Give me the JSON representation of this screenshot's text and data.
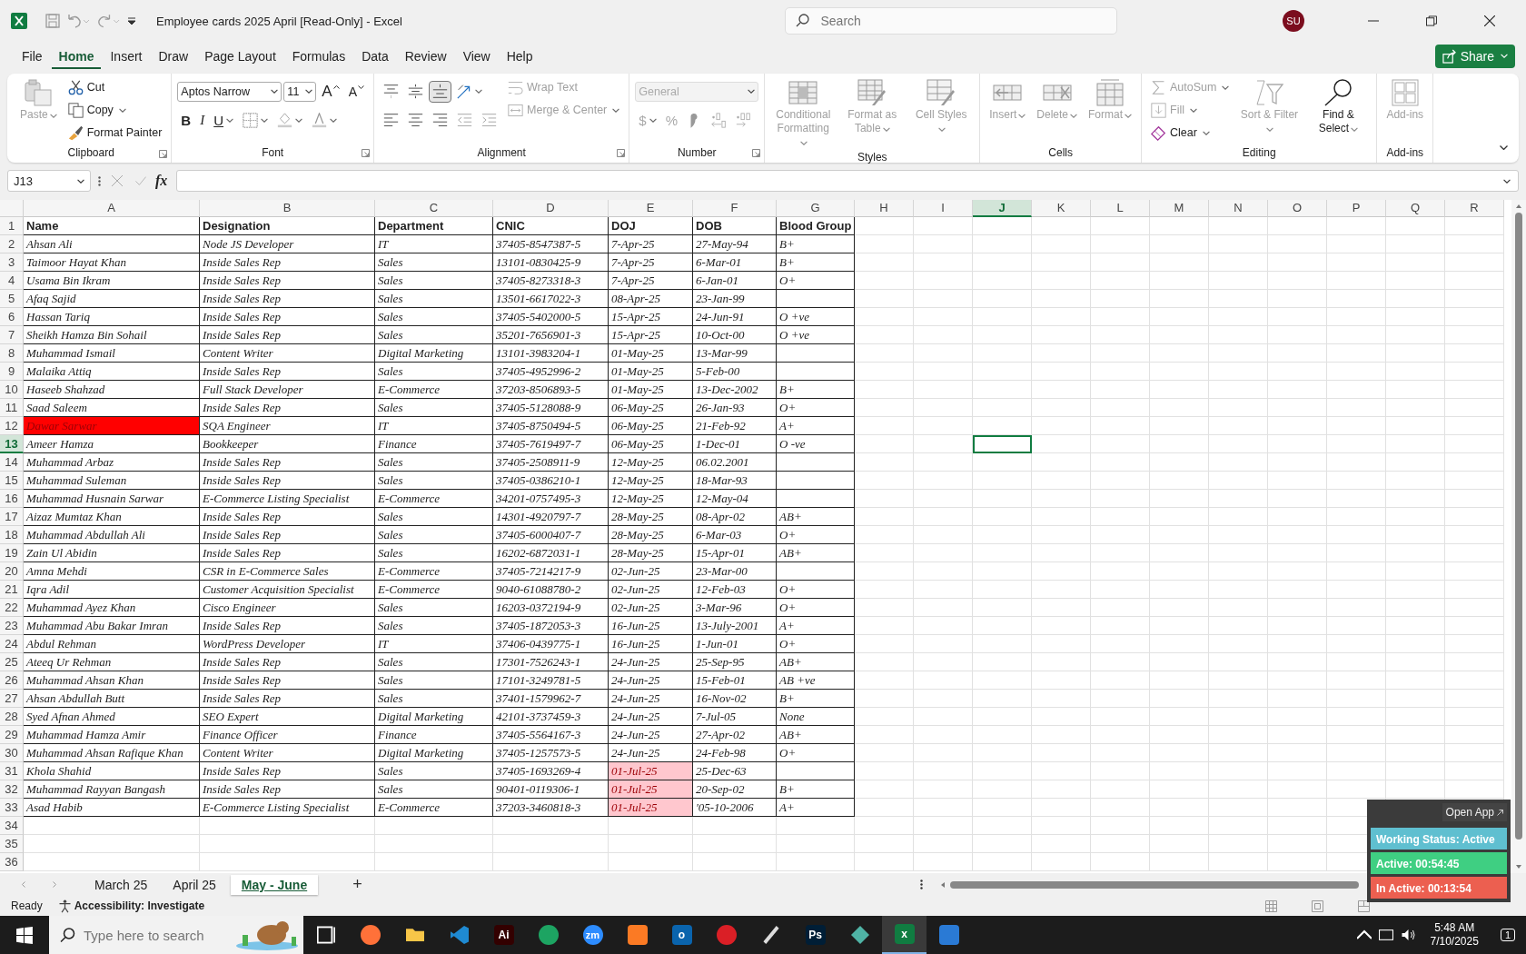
{
  "window": {
    "title": "Employee cards 2025 April  [Read-Only]  -  Excel",
    "search_placeholder": "Search",
    "avatar": "SU"
  },
  "menu_tabs": [
    {
      "label": "File",
      "selected": false
    },
    {
      "label": "Home",
      "selected": true
    },
    {
      "label": "Insert",
      "selected": false
    },
    {
      "label": "Draw",
      "selected": false
    },
    {
      "label": "Page Layout",
      "selected": false
    },
    {
      "label": "Formulas",
      "selected": false
    },
    {
      "label": "Data",
      "selected": false
    },
    {
      "label": "Review",
      "selected": false
    },
    {
      "label": "View",
      "selected": false
    },
    {
      "label": "Help",
      "selected": false
    }
  ],
  "share": "Share",
  "ribbon": [
    {
      "name": "Clipboard",
      "buttons": [
        {
          "label": "Paste",
          "disabled": true
        },
        {
          "label": "Cut",
          "disabled": false
        },
        {
          "label": "Copy",
          "disabled": false
        },
        {
          "label": "Format Painter",
          "disabled": false
        }
      ]
    },
    {
      "name": "Font",
      "font": "Aptos Narrow",
      "size": "11",
      "buttons": [
        {
          "label": "A",
          "disabled": false
        },
        {
          "label": "A",
          "disabled": false
        },
        {
          "label": "B",
          "disabled": false
        },
        {
          "label": "I",
          "disabled": false
        },
        {
          "label": "U",
          "disabled": false
        }
      ]
    },
    {
      "name": "Alignment",
      "vertical": [
        {
          "selected": false
        },
        {
          "selected": false
        },
        {
          "selected": true
        }
      ],
      "buttons": [
        {
          "label": "Wrap Text",
          "disabled": true
        },
        {
          "label": "Merge & Center",
          "disabled": true
        }
      ]
    },
    {
      "name": "Number",
      "number_format": {
        "value": "General",
        "disabled": true
      },
      "buttons": [
        {
          "label": "$",
          "disabled": true
        },
        {
          "label": "%",
          "disabled": true
        }
      ]
    },
    {
      "name": "Styles",
      "buttons": [
        {
          "label": "Conditional Formatting",
          "disabled": true
        },
        {
          "label": "Format as Table",
          "disabled": true
        },
        {
          "label": "Cell Styles",
          "disabled": true
        }
      ]
    },
    {
      "name": "Cells",
      "buttons": [
        {
          "label": "Insert",
          "disabled": true
        },
        {
          "label": "Delete",
          "disabled": true
        },
        {
          "label": "Format",
          "disabled": true
        }
      ]
    },
    {
      "name": "Editing",
      "buttons": [
        {
          "label": "AutoSum",
          "disabled": true
        },
        {
          "label": "Fill",
          "disabled": true
        },
        {
          "label": "Clear",
          "disabled": false
        },
        {
          "label": "Sort & Filter",
          "disabled": true
        },
        {
          "label": "Find & Select",
          "disabled": false
        }
      ]
    },
    {
      "name": "Add-ins",
      "buttons": [
        {
          "label": "Add-ins",
          "disabled": true
        }
      ]
    }
  ],
  "formula_bar": {
    "name_box": "J13",
    "fx": "fx"
  },
  "sheet": {
    "columns": [
      {
        "label": "A",
        "selected": false
      },
      {
        "label": "B",
        "selected": false
      },
      {
        "label": "C",
        "selected": false
      },
      {
        "label": "D",
        "selected": false
      },
      {
        "label": "E",
        "selected": false
      },
      {
        "label": "F",
        "selected": false
      },
      {
        "label": "G",
        "selected": false
      },
      {
        "label": "H",
        "selected": false
      },
      {
        "label": "I",
        "selected": false
      },
      {
        "label": "J",
        "selected": true
      },
      {
        "label": "K",
        "selected": false
      },
      {
        "label": "L",
        "selected": false
      },
      {
        "label": "M",
        "selected": false
      },
      {
        "label": "N",
        "selected": false
      },
      {
        "label": "O",
        "selected": false
      },
      {
        "label": "P",
        "selected": false
      },
      {
        "label": "Q",
        "selected": false
      },
      {
        "label": "R",
        "selected": false
      }
    ],
    "rows": [
      {
        "number": "1",
        "kind": "header",
        "selected": false,
        "cells": [
          "Name",
          "Designation",
          "Department",
          "CNIC",
          "DOJ",
          "DOB",
          "Blood Group"
        ]
      },
      {
        "number": "2",
        "kind": "data",
        "selected": false,
        "cells": [
          "Ahsan Ali",
          "Node JS Developer",
          "IT",
          "37405-8547387-5",
          "7-Apr-25",
          "27-May-94",
          "B+"
        ]
      },
      {
        "number": "3",
        "kind": "data",
        "selected": false,
        "cells": [
          "Taimoor Hayat Khan",
          "Inside Sales Rep",
          "Sales",
          "13101-0830425-9",
          "7-Apr-25",
          "6-Mar-01",
          "B+"
        ]
      },
      {
        "number": "4",
        "kind": "data",
        "selected": false,
        "cells": [
          "Usama Bin Ikram",
          "Inside Sales Rep",
          "Sales",
          "37405-8273318-3",
          "7-Apr-25",
          "6-Jan-01",
          "O+"
        ]
      },
      {
        "number": "5",
        "kind": "data",
        "selected": false,
        "cells": [
          "Afaq Sajid",
          "Inside Sales Rep",
          "Sales",
          "13501-6617022-3",
          "08-Apr-25",
          "23-Jan-99",
          null
        ]
      },
      {
        "number": "6",
        "kind": "data",
        "selected": false,
        "cells": [
          "Hassan Tariq",
          "Inside Sales Rep",
          "Sales",
          "37405-5402000-5",
          "15-Apr-25",
          "24-Jun-91",
          "O +ve"
        ]
      },
      {
        "number": "7",
        "kind": "data",
        "selected": false,
        "cells": [
          "Sheikh Hamza Bin Sohail",
          "Inside Sales Rep",
          "Sales",
          "35201-7656901-3",
          "15-Apr-25",
          "10-Oct-00",
          "O +ve"
        ]
      },
      {
        "number": "8",
        "kind": "data",
        "selected": false,
        "cells": [
          "Muhammad Ismail",
          "Content Writer",
          "Digital Marketing",
          "13101-3983204-1",
          "01-May-25",
          "13-Mar-99",
          null
        ]
      },
      {
        "number": "9",
        "kind": "data",
        "selected": false,
        "cells": [
          "Malaika Attiq",
          "Inside Sales Rep",
          "Sales",
          "37405-4952996-2",
          "01-May-25",
          "5-Feb-00",
          null
        ]
      },
      {
        "number": "10",
        "kind": "data",
        "selected": false,
        "cells": [
          "Haseeb Shahzad",
          "Full Stack Developer",
          "E-Commerce",
          "37203-8506893-5",
          "01-May-25",
          "13-Dec-2002",
          "B+"
        ]
      },
      {
        "number": "11",
        "kind": "data",
        "selected": false,
        "cells": [
          "Saad Saleem",
          "Inside Sales Rep",
          "Sales",
          "37405-5128088-9",
          "06-May-25",
          "26-Jan-93",
          "O+"
        ]
      },
      {
        "number": "12",
        "kind": "data",
        "selected": false,
        "cells": [
          {
            "text": "Dawar Sarwar",
            "color": "#ff0000"
          },
          "SQA Engineer",
          "IT",
          "37405-8750494-5",
          "06-May-25",
          "21-Feb-92",
          "A+"
        ]
      },
      {
        "number": "13",
        "kind": "data",
        "selected": true,
        "cells": [
          "Ameer Hamza",
          "Bookkeeper",
          "Finance",
          "37405-7619497-7",
          "06-May-25",
          "1-Dec-01",
          "O -ve"
        ]
      },
      {
        "number": "14",
        "kind": "data",
        "selected": false,
        "cells": [
          "Muhammad Arbaz",
          "Inside Sales Rep",
          "Sales",
          "37405-2508911-9",
          "12-May-25",
          "06.02.2001",
          null
        ]
      },
      {
        "number": "15",
        "kind": "data",
        "selected": false,
        "cells": [
          "Muhammad Suleman",
          "Inside Sales Rep",
          "Sales",
          "37405-0386210-1",
          "12-May-25",
          "18-Mar-93",
          null
        ]
      },
      {
        "number": "16",
        "kind": "data",
        "selected": false,
        "cells": [
          "Muhammad Husnain Sarwar",
          "E-Commerce Listing Specialist",
          "E-Commerce",
          "34201-0757495-3",
          "12-May-25",
          "12-May-04",
          null
        ]
      },
      {
        "number": "17",
        "kind": "data",
        "selected": false,
        "cells": [
          "Aizaz Mumtaz Khan",
          "Inside Sales Rep",
          "Sales",
          "14301-4920797-7",
          "28-May-25",
          "08-Apr-02",
          "AB+"
        ]
      },
      {
        "number": "18",
        "kind": "data",
        "selected": false,
        "cells": [
          "Muhammad Abdullah Ali",
          "Inside Sales Rep",
          "Sales",
          "37405-6000407-7",
          "28-May-25",
          "6-Mar-03",
          "O+"
        ]
      },
      {
        "number": "19",
        "kind": "data",
        "selected": false,
        "cells": [
          "Zain Ul Abidin",
          "Inside Sales Rep",
          "Sales",
          "16202-6872031-1",
          "28-May-25",
          "15-Apr-01",
          "AB+"
        ]
      },
      {
        "number": "20",
        "kind": "data",
        "selected": false,
        "cells": [
          "Amna Mehdi",
          "CSR in E-Commerce Sales",
          "E-Commerce",
          "37405-7214217-9",
          "02-Jun-25",
          "23-Mar-00",
          null
        ]
      },
      {
        "number": "21",
        "kind": "data",
        "selected": false,
        "cells": [
          "Iqra Adil",
          "Customer Acquisition Specialist",
          "E-Commerce",
          "9040-61088780-2",
          "02-Jun-25",
          "12-Feb-03",
          "O+"
        ]
      },
      {
        "number": "22",
        "kind": "data",
        "selected": false,
        "cells": [
          "Muhammad Ayez Khan",
          "Cisco Engineer",
          "Sales",
          "16203-0372194-9",
          "02-Jun-25",
          "3-Mar-96",
          "O+"
        ]
      },
      {
        "number": "23",
        "kind": "data",
        "selected": false,
        "cells": [
          "Muhammad Abu Bakar Imran",
          "Inside Sales Rep",
          "Sales",
          "37405-1872053-3",
          "16-Jun-25",
          "13-July-2001",
          "A+"
        ]
      },
      {
        "number": "24",
        "kind": "data",
        "selected": false,
        "cells": [
          "Abdul Rehman",
          "WordPress Developer",
          "IT",
          "37406-0439775-1",
          "16-Jun-25",
          "1-Jun-01",
          "O+"
        ]
      },
      {
        "number": "25",
        "kind": "data",
        "selected": false,
        "cells": [
          "Ateeq Ur Rehman",
          "Inside Sales Rep",
          "Sales",
          "17301-7526243-1",
          "24-Jun-25",
          "25-Sep-95",
          "AB+"
        ]
      },
      {
        "number": "26",
        "kind": "data",
        "selected": false,
        "cells": [
          "Muhammad Ahsan Khan",
          "Inside Sales Rep",
          "Sales",
          "17101-3249781-5",
          "24-Jun-25",
          "15-Feb-01",
          "AB +ve"
        ]
      },
      {
        "number": "27",
        "kind": "data",
        "selected": false,
        "cells": [
          "Ahsan Abdullah Butt",
          "Inside Sales Rep",
          "Sales",
          "37401-1579962-7",
          "24-Jun-25",
          "16-Nov-02",
          "B+"
        ]
      },
      {
        "number": "28",
        "kind": "data",
        "selected": false,
        "cells": [
          "Syed Afnan Ahmed",
          "SEO Expert",
          "Digital Marketing",
          "42101-3737459-3",
          "24-Jun-25",
          "7-Jul-05",
          "None"
        ]
      },
      {
        "number": "29",
        "kind": "data",
        "selected": false,
        "cells": [
          "Muhammad Hamza Amir",
          "Finance Officer",
          "Finance",
          "37405-5564167-3",
          "24-Jun-25",
          "27-Apr-02",
          "AB+"
        ]
      },
      {
        "number": "30",
        "kind": "data",
        "selected": false,
        "cells": [
          "Muhammad Ahsan Rafique Khan",
          "Content Writer",
          "Digital Marketing",
          "37405-1257573-5",
          "24-Jun-25",
          "24-Feb-98",
          "O+"
        ]
      },
      {
        "number": "31",
        "kind": "data",
        "selected": false,
        "cells": [
          "Khola Shahid",
          "Inside Sales Rep",
          "Sales",
          "37405-1693269-4",
          {
            "text": "01-Jul-25",
            "color": "#ffc7ce"
          },
          "25-Dec-63",
          null
        ]
      },
      {
        "number": "32",
        "kind": "data",
        "selected": false,
        "cells": [
          "Muhammad Rayyan Bangash",
          "Inside Sales Rep",
          "Sales",
          "90401-0119306-1",
          {
            "text": "01-Jul-25",
            "color": "#ffc7ce"
          },
          "20-Sep-02",
          "B+"
        ]
      },
      {
        "number": "33",
        "kind": "data",
        "selected": false,
        "cells": [
          "Asad Habib",
          "E-Commerce Listing Specialist",
          "E-Commerce",
          "37203-3460818-3",
          {
            "text": "01-Jul-25",
            "color": "#ffc7ce"
          },
          "'05-10-2006",
          "A+"
        ]
      },
      {
        "number": "34",
        "selected": false
      },
      {
        "number": "35",
        "selected": false
      },
      {
        "number": "36",
        "selected": false
      }
    ]
  },
  "sheet_tabs": [
    {
      "label": "March 25",
      "selected": false
    },
    {
      "label": "April 25",
      "selected": false
    },
    {
      "label": "May - June",
      "selected": true
    }
  ],
  "add_sheet": "+",
  "status_bar": {
    "ready": "Ready",
    "accessibility": "Accessibility: Investigate"
  },
  "tracker": {
    "open_app": "Open App",
    "panels": [
      {
        "text": "Working Status: Active",
        "color": "#5fbfd0"
      },
      {
        "text": "Active: 00:54:45",
        "color": "#3fcf82"
      },
      {
        "text": "In Active: 00:13:54",
        "color": "#ec5f50"
      }
    ]
  },
  "taskbar": {
    "search_placeholder": "Type here to search",
    "apps": [
      {
        "kind": "taskview",
        "active": false
      },
      {
        "kind": "round",
        "color": "#ff7139",
        "active": false
      },
      {
        "kind": "folder",
        "color": "#f8c648",
        "active": false
      },
      {
        "kind": "vscode",
        "color": "#1f8ad2",
        "active": false
      },
      {
        "kind": "tile",
        "label": "Ai",
        "color": "#330000",
        "active": false
      },
      {
        "kind": "round",
        "color": "#1da462",
        "active": false
      },
      {
        "kind": "round",
        "label": "zm",
        "color": "#2d8cff",
        "active": false
      },
      {
        "kind": "tile",
        "color": "#fb7a24",
        "active": false
      },
      {
        "kind": "tile",
        "label": "o",
        "color": "#0a64ad",
        "active": false
      },
      {
        "kind": "round",
        "color": "#da1f26",
        "active": false
      },
      {
        "kind": "pen",
        "active": false
      },
      {
        "kind": "tile",
        "label": "Ps",
        "color": "#001e36",
        "active": false
      },
      {
        "kind": "gem",
        "color": "#4fb3a5",
        "active": false
      },
      {
        "kind": "tile",
        "label": "x",
        "color": "#107c41",
        "active": true
      },
      {
        "kind": "tile",
        "color": "#2a7ad5",
        "active": false
      }
    ],
    "time": "5:48 AM",
    "date": "7/10/2025",
    "notifications": "1"
  }
}
